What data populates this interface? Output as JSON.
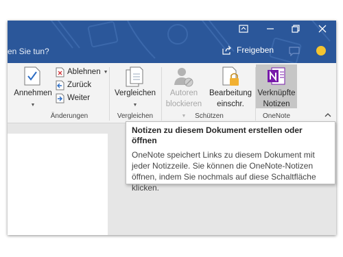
{
  "window": {
    "tell_me": "en Sie tun?",
    "share_label": "Freigeben",
    "controls": [
      "ribbon-display-options",
      "minimize",
      "restore",
      "close"
    ]
  },
  "ribbon": {
    "changes": {
      "accept_label": "Annehmen",
      "reject_label": "Ablehnen",
      "back_label": "Zurück",
      "next_label": "Weiter",
      "group_label": "Änderungen"
    },
    "compare": {
      "button_label": "Vergleichen",
      "group_label": "Vergleichen"
    },
    "protect": {
      "block_authors_line1": "Autoren",
      "block_authors_line2": "blockieren",
      "restrict_editing_line1": "Bearbeitung",
      "restrict_editing_line2": "einschr.",
      "group_label": "Schützen"
    },
    "onenote": {
      "linked_notes_line1": "Verknüpfte",
      "linked_notes_line2": "Notizen",
      "group_label": "OneNote"
    }
  },
  "tooltip": {
    "title": "Notizen zu diesem Dokument erstellen oder öffnen",
    "body": "OneNote speichert Links zu diesem Dokument mit jeder Notizzeile. Sie können die OneNote-Notizen öffnen, indem Sie nochmals auf diese Schaltfläche klicken."
  },
  "colors": {
    "titlebar": "#2b579a",
    "onenote_purple": "#7719aa",
    "ribbon_bg": "#f3f3f3",
    "workspace": "#e6e6e6"
  }
}
